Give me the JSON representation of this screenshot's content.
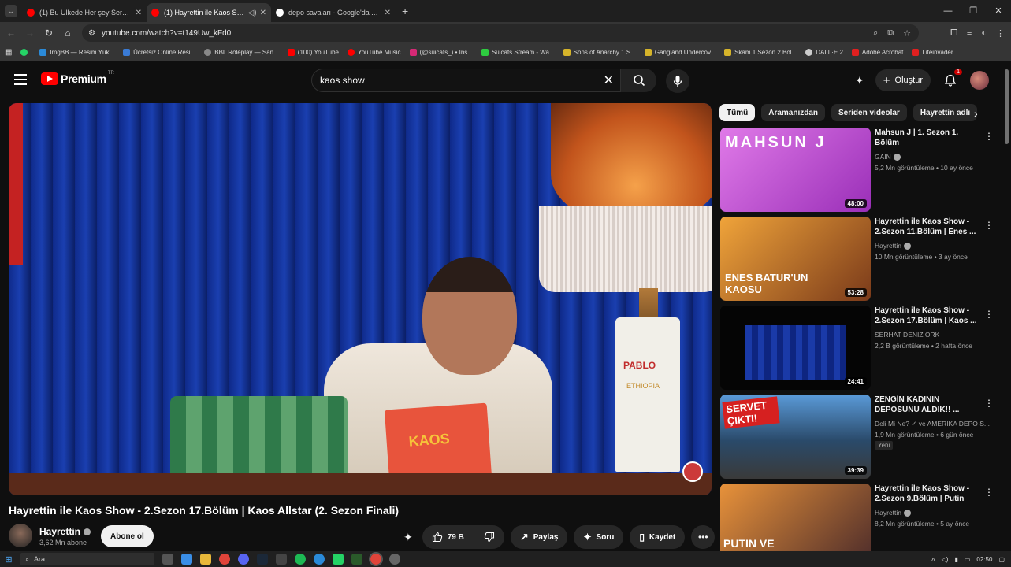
{
  "browser": {
    "tabs": [
      {
        "title": "(1) Bu Ülkede Her şey Serbest",
        "favicon_color": "#ff0000",
        "active": false
      },
      {
        "title": "(1) Hayrettin ile Kaos Show",
        "favicon_color": "#ff0000",
        "active": true
      },
      {
        "title": "depo savaları - Google'da Ara",
        "favicon_color": "#4285f4",
        "active": false
      }
    ],
    "new_tab": "+",
    "window_controls": {
      "minimize": "—",
      "maximize": "❐",
      "close": "✕"
    },
    "url": "youtube.com/watch?v=t149Uw_kFd0",
    "bookmarks": [
      {
        "label": "",
        "color": "#25d366"
      },
      {
        "label": "ImgBB — Resim Yük...",
        "color": "#2b8ad8"
      },
      {
        "label": "Ücretsiz Online Resi...",
        "color": "#3a7bd5"
      },
      {
        "label": "BBL Roleplay — San...",
        "color": "#888888"
      },
      {
        "label": "(100) YouTube",
        "color": "#ff0000"
      },
      {
        "label": "YouTube Music",
        "color": "#ff0000"
      },
      {
        "label": "(@suicats_) • Ins...",
        "color": "#d62976"
      },
      {
        "label": "Suicats Stream - Wa...",
        "color": "#2ecc40"
      },
      {
        "label": "Sons of Anarchy 1.S...",
        "color": "#d6b42a"
      },
      {
        "label": "Gangland Undercov...",
        "color": "#d6b42a"
      },
      {
        "label": "Skam 1.Sezon 2.Böl...",
        "color": "#d6b42a"
      },
      {
        "label": "DALL·E 2",
        "color": "#cccccc"
      },
      {
        "label": "Adobe Acrobat",
        "color": "#e02020"
      },
      {
        "label": "Lifeinvader",
        "color": "#e02020"
      }
    ]
  },
  "yt": {
    "logo_word": "Premium",
    "logo_sup": "TR",
    "search_query": "kaos show",
    "create_label": "Oluştur",
    "notif_count": "1"
  },
  "video": {
    "title": "Hayrettin ile Kaos Show - 2.Sezon 17.Bölüm | Kaos Allstar (2. Sezon Finali)",
    "channel": "Hayrettin",
    "subscribers": "3,62 Mn abone",
    "subscribe_label": "Abone ol",
    "likes": "79 B",
    "share_label": "Paylaş",
    "ask_label": "Soru",
    "save_label": "Kaydet",
    "bag_text": "PABLO",
    "bag_sub": "ETHIOPIA",
    "card_text": "KAOS"
  },
  "chips": [
    "Tümü",
    "Aramanızdan",
    "Seriden videolar",
    "Hayrettin adlı"
  ],
  "recommendations": [
    {
      "title": "Mahsun J | 1. Sezon 1. Bölüm",
      "channel": "GAİN",
      "meta": "5,2 Mn görüntüleme • 10 ay önce",
      "duration": "48:00",
      "thumb_text": "MAHSUN J",
      "thumb_color": "#c94fd0",
      "new": ""
    },
    {
      "title": "Hayrettin ile Kaos Show - 2.Sezon 11.Bölüm | Enes ...",
      "channel": "Hayrettin",
      "meta": "10 Mn görüntüleme • 3 ay önce",
      "duration": "53:28",
      "thumb_text": "ENES BATUR'UN KAOSU",
      "thumb_color": "#e08a2a",
      "new": ""
    },
    {
      "title": "Hayrettin ile Kaos Show - 2.Sezon 17.Bölüm | Kaos ...",
      "channel": "SERHAT DENİZ ÖRK",
      "meta": "2,2 B görüntüleme • 2 hafta önce",
      "duration": "24:41",
      "thumb_text": "",
      "thumb_color": "#1c2a7a",
      "new": ""
    },
    {
      "title": "ZENGİN KADININ DEPOSUNU ALDIK!! ...",
      "channel": "Deli Mi Ne? ✓ ve AMERİKA DEPO S...",
      "meta": "1,9 Mn görüntüleme • 6 gün önce",
      "duration": "39:39",
      "thumb_text": "SERVET ÇIKTI!",
      "thumb_color": "#3a6ea8",
      "new": "Yeni"
    },
    {
      "title": "Hayrettin ile Kaos Show - 2.Sezon 9.Bölüm | Putin ve...",
      "channel": "Hayrettin",
      "meta": "8,2 Mn görüntüleme • 5 ay önce",
      "duration": "",
      "thumb_text": "PUTIN VE",
      "thumb_color": "#d0782a",
      "new": ""
    }
  ],
  "taskbar": {
    "search_placeholder": "Ara",
    "clock": "02:50"
  }
}
